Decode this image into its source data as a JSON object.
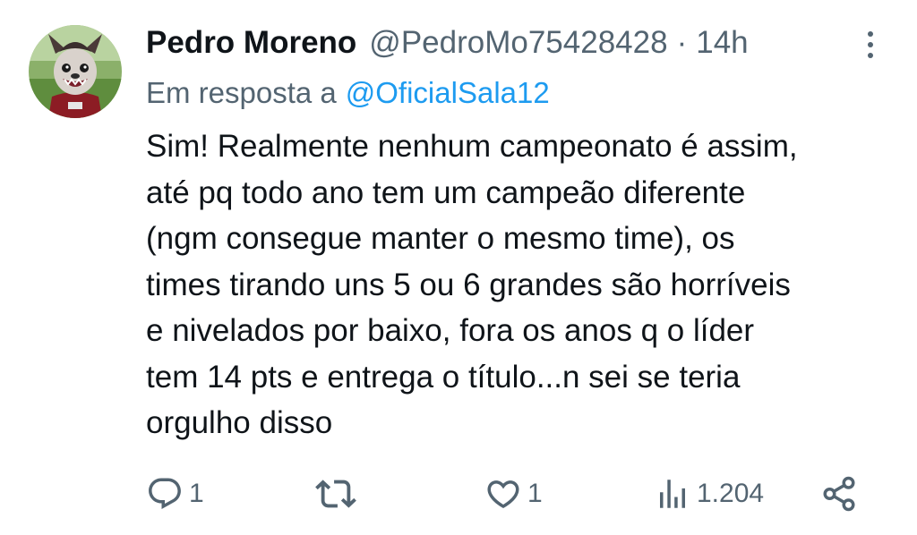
{
  "tweet": {
    "author_name": "Pedro Moreno",
    "handle": "@PedroMo75428428",
    "separator": "·",
    "time": "14h",
    "reply_prefix": "Em resposta a",
    "reply_to": "@OficialSala12",
    "body_lines": [
      "Sim! Realmente nenhum campeonato é assim,",
      "até pq todo ano tem um campeão diferente",
      "(ngm consegue manter o mesmo time), os",
      "times tirando uns 5 ou 6 grandes são horríveis",
      "e nivelados por baixo, fora os anos q o líder",
      "tem 14 pts e entrega o título...n sei se teria",
      "orgulho disso"
    ]
  },
  "actions": {
    "reply_count": "1",
    "retweet_count": "",
    "like_count": "1",
    "views_count": "1.204"
  },
  "icons": {
    "avatar": "avatar-mascot-icon",
    "more": "more-vertical-icon",
    "reply": "reply-icon",
    "retweet": "retweet-icon",
    "like": "heart-icon",
    "views": "views-chart-icon",
    "share": "share-icon"
  },
  "colors": {
    "text": "#0f1419",
    "secondary": "#536471",
    "link": "#1d9bf0"
  }
}
